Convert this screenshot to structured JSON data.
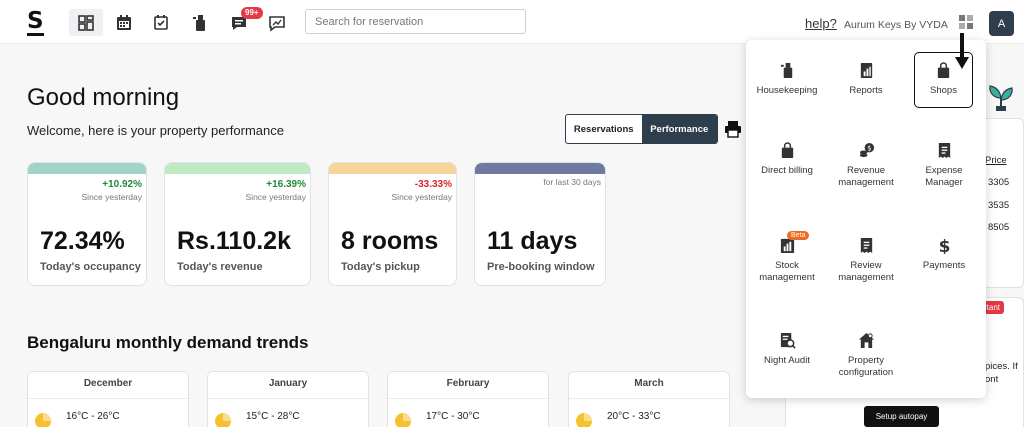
{
  "brand": {
    "logo": "S"
  },
  "nav": {
    "notification_count": "99+"
  },
  "search": {
    "placeholder": "Search for reservation"
  },
  "header": {
    "help": "help?",
    "property_name": "Aurum Keys By VYDA",
    "avatar_initial": "A"
  },
  "greeting": {
    "title": "Good morning",
    "subtitle": "Welcome, here is your property performance"
  },
  "view_toggle": {
    "reservations": "Reservations",
    "performance": "Performance",
    "selected": "Performance"
  },
  "metrics": [
    {
      "delta": "+10.92%",
      "since": "Since yesterday",
      "value": "72.34%",
      "label": "Today's occupancy",
      "strip_color": "#9fd4c6"
    },
    {
      "delta": "+16.39%",
      "since": "Since yesterday",
      "value": "Rs.110.2k",
      "label": "Today's revenue",
      "strip_color": "#bfeac3"
    },
    {
      "delta": "-33.33%",
      "since": "Since yesterday",
      "value": "8 rooms",
      "label": "Today's pickup",
      "strip_color": "#f7d49a"
    },
    {
      "delta": "",
      "since": "for last 30 days",
      "value": "11 days",
      "label": "Pre-booking window",
      "strip_color": "#6f7aa3"
    }
  ],
  "demand": {
    "title": "Bengaluru monthly demand trends",
    "months": [
      {
        "name": "December",
        "temp": "16°C - 26°C"
      },
      {
        "name": "January",
        "temp": "15°C - 28°C"
      },
      {
        "name": "February",
        "temp": "17°C - 30°C"
      },
      {
        "name": "March",
        "temp": "20°C - 33°C"
      }
    ]
  },
  "side_panel": {
    "price_header": "Price",
    "prices": [
      "3305",
      "3535",
      "8505"
    ],
    "important": "rtant",
    "note_line1": "pices. If",
    "note_line2": "ont",
    "setup_button": "Setup autopay"
  },
  "apps_menu": {
    "items": [
      {
        "label": "Housekeeping",
        "icon": "housekeeping-icon"
      },
      {
        "label": "Reports",
        "icon": "reports-icon"
      },
      {
        "label": "Shops",
        "icon": "shop-bag-icon",
        "highlighted": true
      },
      {
        "label": "Direct billing",
        "icon": "billing-bag-icon"
      },
      {
        "label": "Revenue management",
        "icon": "revenue-icon"
      },
      {
        "label": "Expense Manager",
        "icon": "expense-icon"
      },
      {
        "label": "Stock management",
        "icon": "stock-icon",
        "badge": "Beta"
      },
      {
        "label": "Review management",
        "icon": "review-icon"
      },
      {
        "label": "Payments",
        "icon": "dollar-icon"
      },
      {
        "label": "Night Audit",
        "icon": "night-audit-icon"
      },
      {
        "label": "Property configuration",
        "icon": "property-icon"
      }
    ]
  },
  "colors": {
    "primary": "#2f3e4c",
    "badge": "#e53946",
    "positive": "#1f8a3a",
    "negative": "#d8242b",
    "beta": "#ee6c22"
  }
}
